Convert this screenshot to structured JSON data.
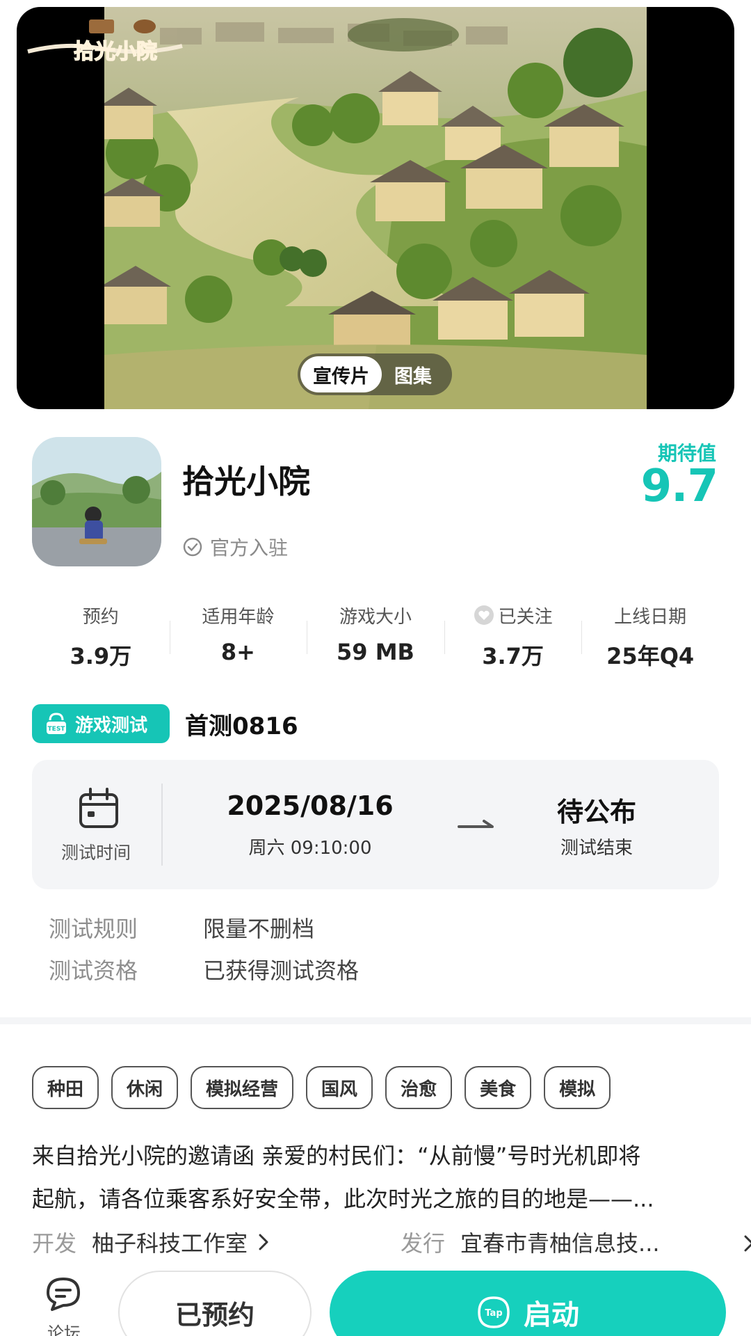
{
  "hero": {
    "logo_text": "拾光小院",
    "tabs": [
      {
        "label": "宣传片",
        "active": true
      },
      {
        "label": "图集",
        "active": false
      }
    ]
  },
  "game": {
    "title": "拾光小院",
    "official_label": "官方入驻",
    "expect_label": "期待值",
    "expect_score": "9.7"
  },
  "stats": [
    {
      "label": "预约",
      "value": "3.9万"
    },
    {
      "label": "适用年龄",
      "value": "8+"
    },
    {
      "label": "游戏大小",
      "value": "59 MB"
    },
    {
      "label": "已关注",
      "value": "3.7万",
      "icon": "heart-icon"
    },
    {
      "label": "上线日期",
      "value": "25年Q4"
    }
  ],
  "test": {
    "badge_label": "游戏测试",
    "badge_icon_text": "TEST",
    "name": "首测0816",
    "time_label": "测试时间",
    "start_date": "2025/08/16",
    "start_time": "周六  09:10:00",
    "end_status": "待公布",
    "end_label": "测试结束",
    "rules": [
      {
        "key": "测试规则",
        "value": "限量不删档"
      },
      {
        "key": "测试资格",
        "value": "已获得测试资格"
      }
    ]
  },
  "tags": [
    "种田",
    "休闲",
    "模拟经营",
    "国风",
    "治愈",
    "美食",
    "模拟"
  ],
  "description": {
    "line1": "来自拾光小院的邀请函 亲爱的村民们：“从前慢”号时光机即将",
    "line2": "起航，请各位乘客系好安全带，此次时光之旅的目的地是——..."
  },
  "credits": {
    "dev_label": "开发",
    "dev_value": "柚子科技工作室",
    "pub_label": "发行",
    "pub_value": "宜春市青柚信息技..."
  },
  "bottom_bar": {
    "forum_label": "论坛",
    "reserved_label": "已预约",
    "launch_label": "启动",
    "tap_icon_text": "Tap"
  },
  "colors": {
    "accent": "#16c5b6",
    "launch": "#16d0bd",
    "card_bg": "#f4f5f7"
  }
}
